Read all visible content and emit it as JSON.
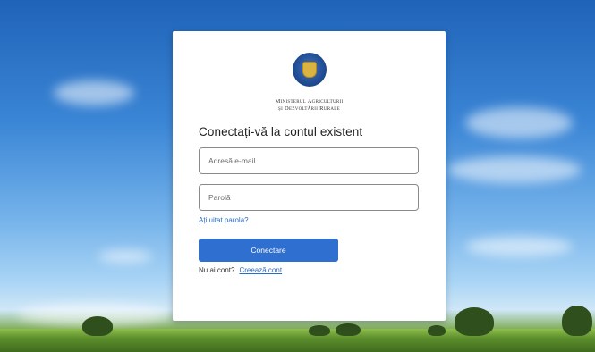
{
  "ministry": {
    "line1": "Ministerul Agriculturii",
    "line2": "și Dezvoltării Rurale"
  },
  "login": {
    "title": "Conectați-vă la contul existent",
    "email_placeholder": "Adresă e-mail",
    "password_placeholder": "Parolă",
    "forgot_link": "Ați uitat parola?",
    "submit_label": "Conectare",
    "no_account_text": "Nu ai cont?",
    "create_account_link": "Creează cont"
  },
  "colors": {
    "primary": "#2f6fcf",
    "link": "#2b6cc4",
    "card_bg": "#ffffff"
  }
}
